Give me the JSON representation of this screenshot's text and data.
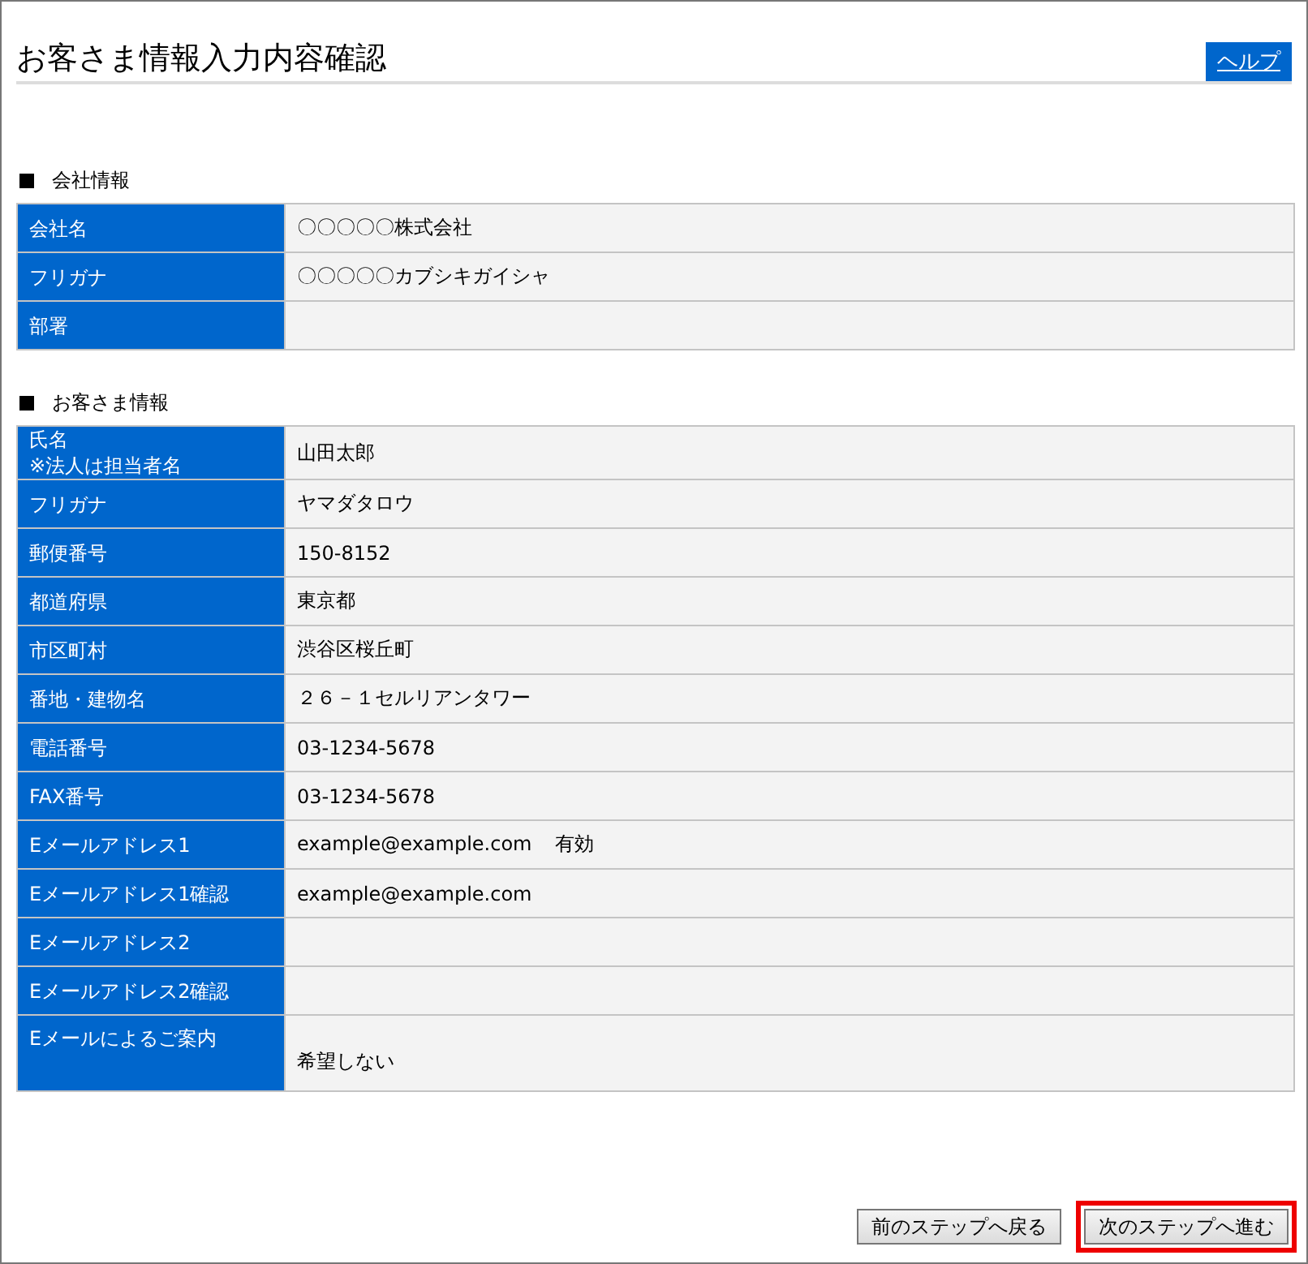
{
  "page": {
    "title": "お客さま情報入力内容確認",
    "help_link": "ヘルプ"
  },
  "sections": [
    {
      "heading": "会社情報",
      "rows": [
        {
          "label": "会社名",
          "value": "〇〇〇〇〇株式会社"
        },
        {
          "label": "フリガナ",
          "value": "〇〇〇〇〇カブシキガイシャ"
        },
        {
          "label": "部署"
        }
      ]
    },
    {
      "heading": "お客さま情報",
      "rows": [
        {
          "label": "氏名\n※法人は担当者名",
          "value": "山田太郎"
        },
        {
          "label": "フリガナ",
          "value": "ヤマダタロウ"
        },
        {
          "label": "郵便番号",
          "value": "150-8152"
        },
        {
          "label": "都道府県",
          "value": "東京都"
        },
        {
          "label": "市区町村",
          "value": "渋谷区桜丘町"
        },
        {
          "label": "番地・建物名",
          "value": "２６－１セルリアンタワー"
        },
        {
          "label": "電話番号",
          "value": "03-1234-5678"
        },
        {
          "label": "FAX番号",
          "value": "03-1234-5678"
        },
        {
          "label": "Eメールアドレス1",
          "value": "example@example.com",
          "note": "有効"
        },
        {
          "label": "Eメールアドレス1確認",
          "value": "example@example.com"
        },
        {
          "label": "Eメールアドレス2"
        },
        {
          "label": "Eメールアドレス2確認"
        },
        {
          "label": "Eメールによるご案内",
          "value": "希望しない",
          "tall": true
        }
      ]
    }
  ],
  "buttons": [
    {
      "label": "前のステップへ戻る",
      "highlighted": false
    },
    {
      "label": "次のステップへ進む",
      "highlighted": true
    }
  ]
}
